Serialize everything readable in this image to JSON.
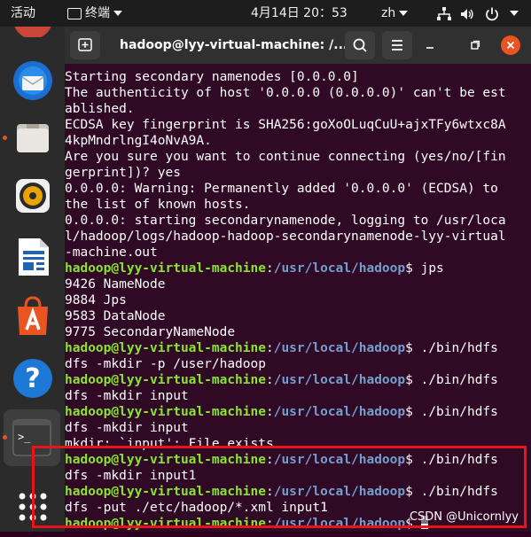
{
  "topbar": {
    "activities": "活动",
    "app_name": "终端",
    "datetime": "4月14日  20：53",
    "input_method": "zh"
  },
  "dock": {
    "items": [
      "thunderbird",
      "files",
      "rhythmbox",
      "libreoffice-writer",
      "ubuntu-software",
      "help",
      "terminal",
      "show-applications"
    ]
  },
  "window": {
    "title": "hadoop@lyy-virtual-machine: /..."
  },
  "terminal": {
    "lines": [
      {
        "text": "Starting secondary namenodes [0.0.0.0]"
      },
      {
        "text": "The authenticity of host '0.0.0.0 (0.0.0.0)' can't be est"
      },
      {
        "text": "ablished."
      },
      {
        "text": "ECDSA key fingerprint is SHA256:goXoOLuqCuU+ajxTFy6wtxc8A"
      },
      {
        "text": "4kpMndrlngI4oNvA9A."
      },
      {
        "text": "Are you sure you want to continue connecting (yes/no/[fin"
      },
      {
        "text": "gerprint])? yes"
      },
      {
        "text": "0.0.0.0: Warning: Permanently added '0.0.0.0' (ECDSA) to"
      },
      {
        "text": "the list of known hosts."
      },
      {
        "text": "0.0.0.0: starting secondarynamenode, logging to /usr/loca"
      },
      {
        "text": "l/hadoop/logs/hadoop-hadoop-secondarynamenode-lyy-virtual"
      },
      {
        "text": "-machine.out"
      },
      {
        "user": "hadoop@lyy-virtual-machine",
        "sep": ":",
        "path": "/usr/local/hadoop",
        "cmd": "$ jps"
      },
      {
        "text": "9426 NameNode"
      },
      {
        "text": "9884 Jps"
      },
      {
        "text": "9583 DataNode"
      },
      {
        "text": "9775 SecondaryNameNode"
      },
      {
        "user": "hadoop@lyy-virtual-machine",
        "sep": ":",
        "path": "/usr/local/hadoop",
        "cmd": "$ ./bin/hdfs"
      },
      {
        "text": "dfs -mkdir -p /user/hadoop"
      },
      {
        "user": "hadoop@lyy-virtual-machine",
        "sep": ":",
        "path": "/usr/local/hadoop",
        "cmd": "$ ./bin/hdfs"
      },
      {
        "text": "dfs -mkdir input"
      },
      {
        "user": "hadoop@lyy-virtual-machine",
        "sep": ":",
        "path": "/usr/local/hadoop",
        "cmd": "$ ./bin/hdfs"
      },
      {
        "text": "dfs -mkdir input"
      },
      {
        "text": "mkdir: `input': File exists"
      },
      {
        "user": "hadoop@lyy-virtual-machine",
        "sep": ":",
        "path": "/usr/local/hadoop",
        "cmd": "$ ./bin/hdfs"
      },
      {
        "text": "dfs -mkdir input1"
      },
      {
        "user": "hadoop@lyy-virtual-machine",
        "sep": ":",
        "path": "/usr/local/hadoop",
        "cmd": "$ ./bin/hdfs"
      },
      {
        "text": "dfs -put ./etc/hadoop/*.xml input1"
      },
      {
        "user": "hadoop@lyy-virtual-machine",
        "sep": ":",
        "path": "/usr/local/hadoop",
        "cmd": "$ ",
        "cursor": true
      }
    ]
  },
  "watermark": "CSDN @Unicornlyy",
  "colors": {
    "terminal_bg": "#300a24",
    "prompt_user": "#8ae234",
    "prompt_path": "#729fcf",
    "highlight_box": "#e8141a",
    "close_button": "#e95420"
  }
}
